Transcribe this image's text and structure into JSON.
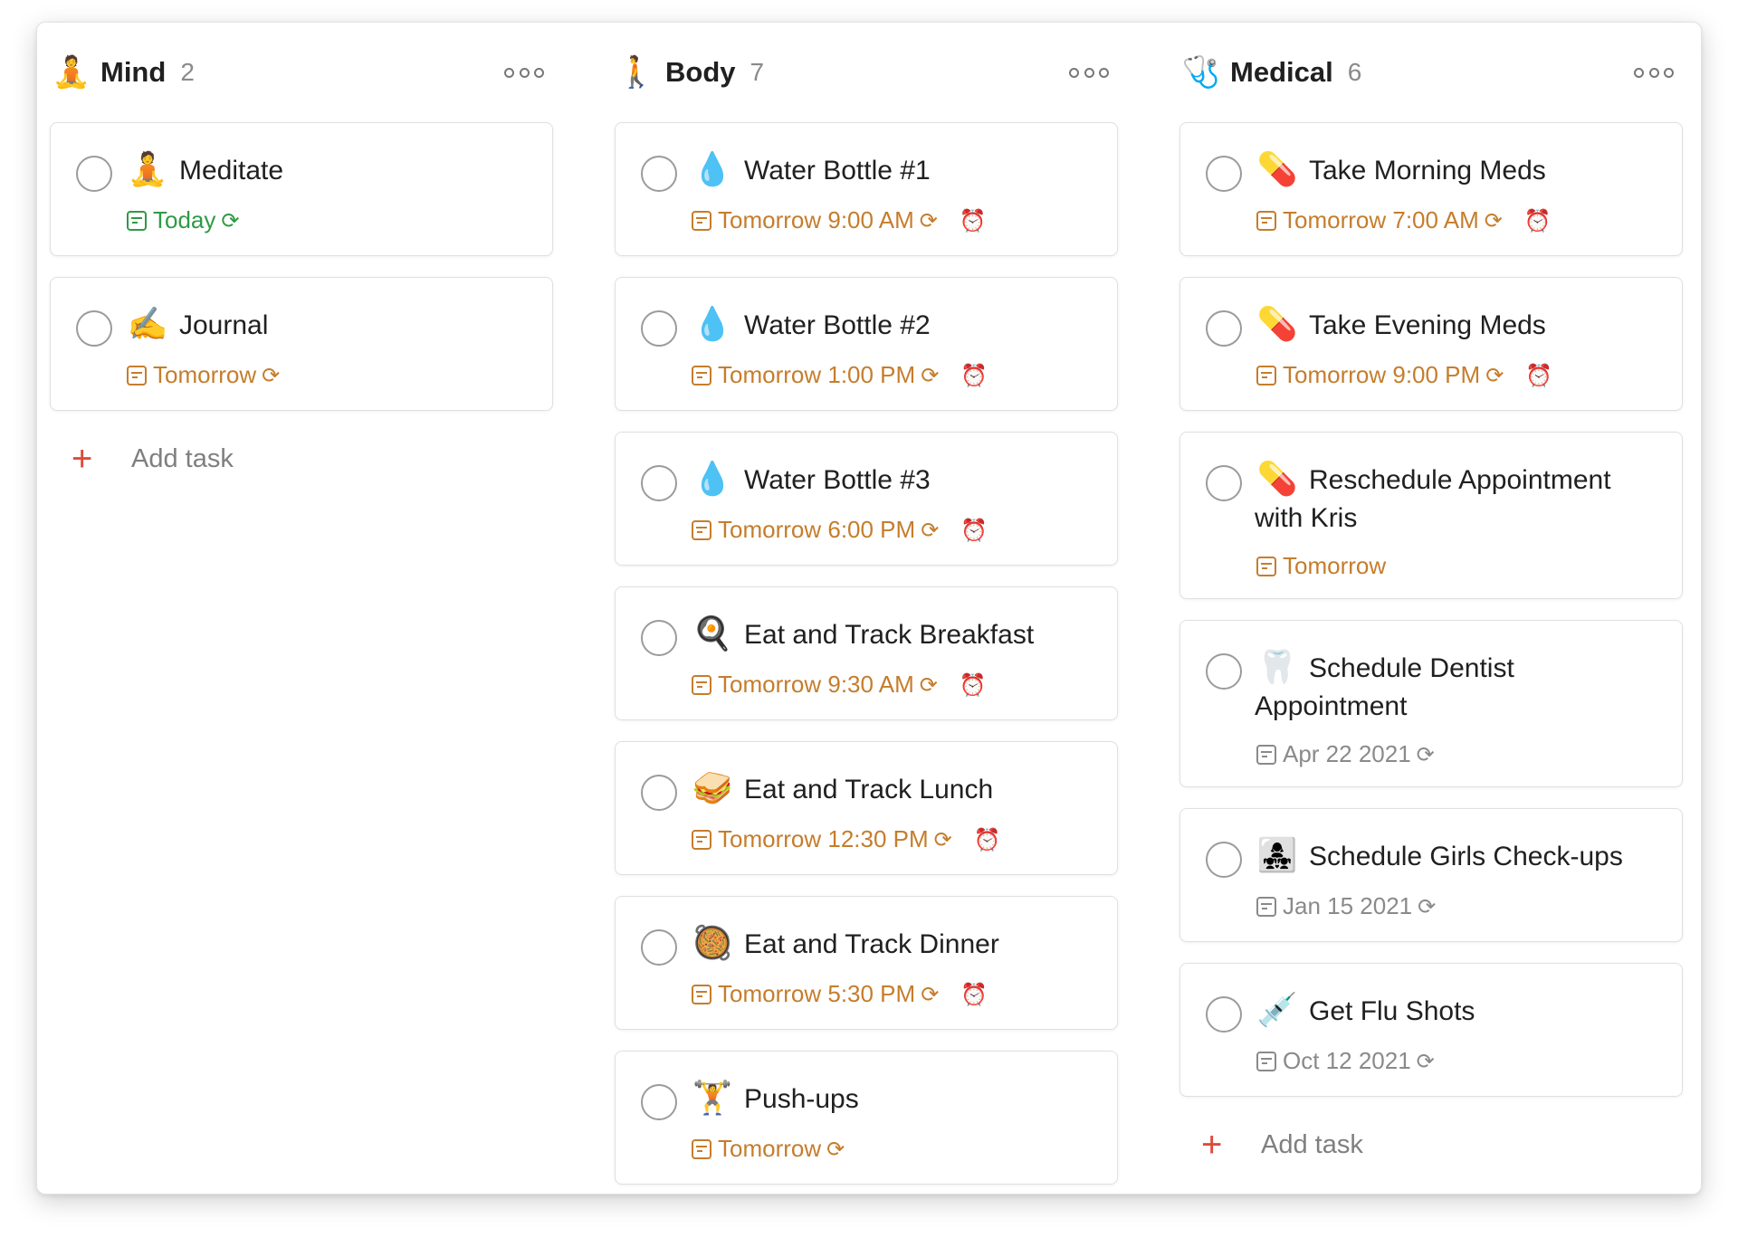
{
  "columns": [
    {
      "id": "mind",
      "emoji": "🧘",
      "title": "Mind",
      "count": "2",
      "tasks": [
        {
          "emoji": "🧘",
          "title": "Meditate",
          "date": "Today",
          "date_color": "#2f9a46",
          "recurring": true,
          "alarm": false
        },
        {
          "emoji": "✍️",
          "title": "Journal",
          "date": "Tomorrow",
          "date_color": "#c57d2c",
          "recurring": true,
          "alarm": false
        }
      ],
      "add_label": "Add task"
    },
    {
      "id": "body",
      "emoji": "🚶",
      "title": "Body",
      "count": "7",
      "tasks": [
        {
          "emoji": "💧",
          "title": "Water Bottle #1",
          "date": "Tomorrow 9:00 AM",
          "date_color": "#c57d2c",
          "recurring": true,
          "alarm": true
        },
        {
          "emoji": "💧",
          "title": "Water Bottle #2",
          "date": "Tomorrow 1:00 PM",
          "date_color": "#c57d2c",
          "recurring": true,
          "alarm": true
        },
        {
          "emoji": "💧",
          "title": "Water Bottle #3",
          "date": "Tomorrow 6:00 PM",
          "date_color": "#c57d2c",
          "recurring": true,
          "alarm": true
        },
        {
          "emoji": "🍳",
          "title": "Eat and Track Breakfast",
          "date": "Tomorrow 9:30 AM",
          "date_color": "#c57d2c",
          "recurring": true,
          "alarm": true
        },
        {
          "emoji": "🥪",
          "title": "Eat and Track Lunch",
          "date": "Tomorrow 12:30 PM",
          "date_color": "#c57d2c",
          "recurring": true,
          "alarm": true
        },
        {
          "emoji": "🥘",
          "title": "Eat and Track Dinner",
          "date": "Tomorrow 5:30 PM",
          "date_color": "#c57d2c",
          "recurring": true,
          "alarm": true
        },
        {
          "emoji": "🏋️",
          "title": "Push-ups",
          "date": "Tomorrow",
          "date_color": "#c57d2c",
          "recurring": true,
          "alarm": false
        }
      ]
    },
    {
      "id": "medical",
      "emoji": "🩺",
      "title": "Medical",
      "count": "6",
      "tasks": [
        {
          "emoji": "💊",
          "title": "Take Morning Meds",
          "date": "Tomorrow 7:00 AM",
          "date_color": "#c57d2c",
          "recurring": true,
          "alarm": true
        },
        {
          "emoji": "💊",
          "title": "Take Evening Meds",
          "date": "Tomorrow 9:00 PM",
          "date_color": "#c57d2c",
          "recurring": true,
          "alarm": true
        },
        {
          "emoji": "💊",
          "title": "Reschedule Appointment with Kris",
          "date": "Tomorrow",
          "date_color": "#c57d2c",
          "recurring": false,
          "alarm": false
        },
        {
          "emoji": "🦷",
          "title": "Schedule Dentist Appointment",
          "date": "Apr 22 2021",
          "date_color": "#8a8a8a",
          "recurring": true,
          "alarm": false
        },
        {
          "emoji": "👩‍👧‍👧",
          "title": "Schedule Girls Check-ups",
          "date": "Jan 15 2021",
          "date_color": "#8a8a8a",
          "recurring": true,
          "alarm": false
        },
        {
          "emoji": "💉",
          "title": "Get Flu Shots",
          "date": "Oct 12 2021",
          "date_color": "#8a8a8a",
          "recurring": true,
          "alarm": false
        }
      ],
      "add_label": "Add task"
    }
  ],
  "icons": {
    "more": "more-horizontal-icon",
    "calendar": "calendar-icon",
    "repeat": "repeat-icon",
    "alarm": "alarm-clock-icon",
    "add": "plus-icon"
  }
}
